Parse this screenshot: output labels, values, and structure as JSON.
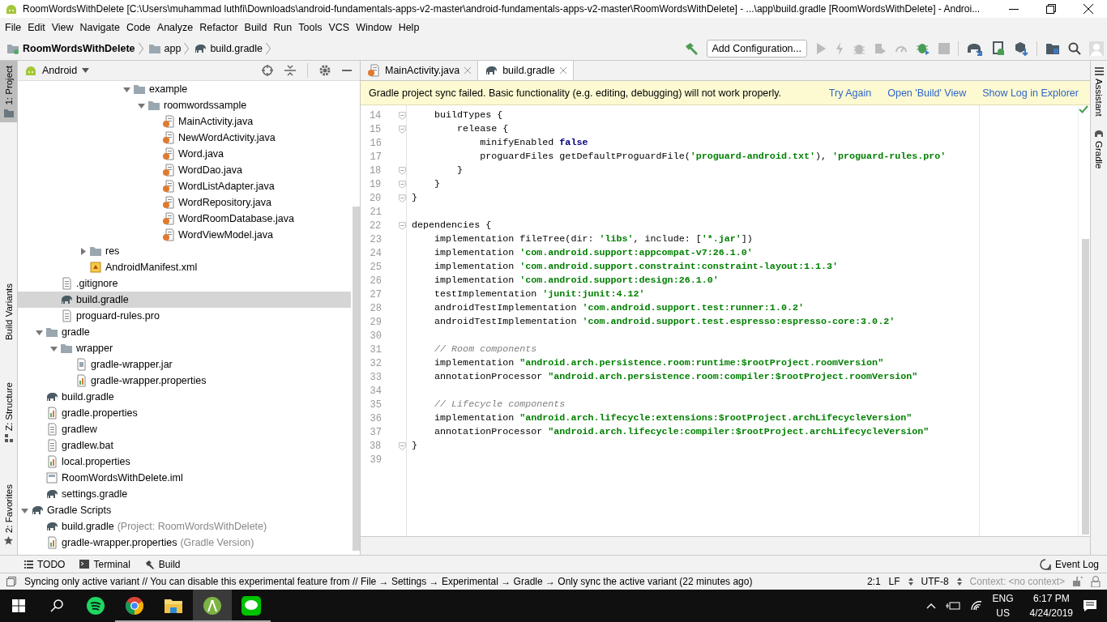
{
  "window": {
    "title": "RoomWordsWithDelete [C:\\Users\\muhammad luthfi\\Downloads\\android-fundamentals-apps-v2-master\\android-fundamentals-apps-v2-master\\RoomWordsWithDelete] - ...\\app\\build.gradle [RoomWordsWithDelete] - Androi..."
  },
  "menu": [
    "File",
    "Edit",
    "View",
    "Navigate",
    "Code",
    "Analyze",
    "Refactor",
    "Build",
    "Run",
    "Tools",
    "VCS",
    "Window",
    "Help"
  ],
  "breadcrumbs": [
    {
      "label": "RoomWordsWithDelete",
      "kind": "project"
    },
    {
      "label": "app",
      "kind": "folder"
    },
    {
      "label": "build.gradle",
      "kind": "gradle"
    }
  ],
  "toolbar": {
    "run_config": "Add Configuration..."
  },
  "left_tool_tabs": [
    {
      "label": "1: Project",
      "kind": "project",
      "selected": true
    },
    {
      "label": "Build Variants",
      "kind": "plain",
      "selected": false
    },
    {
      "label": "Z: Structure",
      "kind": "structure",
      "selected": false
    },
    {
      "label": "2: Favorites",
      "kind": "favorites",
      "selected": false
    }
  ],
  "project_panel": {
    "view": "Android",
    "tree": [
      {
        "children": [
          {
            "children": [
              {
                "children": [
                  {
                    "children": [
                      {
                        "children": [
                          {
                            "children": [
                              {
                                "children": [
                                  {
                                    "label": "example",
                                    "kind": "folder",
                                    "selected": false,
                                    "expanded": true,
                                    "children": [
                                      {
                                        "label": "roomwordssample",
                                        "kind": "folder",
                                        "selected": false,
                                        "expanded": true,
                                        "children": [
                                          {
                                            "label": "MainActivity.java",
                                            "kind": "java",
                                            "selected": false
                                          },
                                          {
                                            "label": "NewWordActivity.java",
                                            "kind": "java",
                                            "selected": false
                                          },
                                          {
                                            "label": "Word.java",
                                            "kind": "java",
                                            "selected": false
                                          },
                                          {
                                            "label": "WordDao.java",
                                            "kind": "java",
                                            "selected": false
                                          },
                                          {
                                            "label": "WordListAdapter.java",
                                            "kind": "java",
                                            "selected": false
                                          },
                                          {
                                            "label": "WordRepository.java",
                                            "kind": "java",
                                            "selected": false
                                          },
                                          {
                                            "label": "WordRoomDatabase.java",
                                            "kind": "java",
                                            "selected": false
                                          },
                                          {
                                            "label": "WordViewModel.java",
                                            "kind": "java",
                                            "selected": false
                                          }
                                        ]
                                      }
                                    ]
                                  }
                                ]
                              }
                            ]
                          }
                        ]
                      },
                      {
                        "label": "res",
                        "kind": "folder",
                        "selected": false,
                        "expanded": false
                      },
                      {
                        "label": "AndroidManifest.xml",
                        "kind": "manifest",
                        "selected": false
                      }
                    ]
                  }
                ]
              },
              {
                "label": ".gitignore",
                "kind": "text",
                "selected": false
              },
              {
                "label": "build.gradle",
                "kind": "gradle",
                "selected": true
              },
              {
                "label": "proguard-rules.pro",
                "kind": "text",
                "selected": false
              }
            ]
          },
          {
            "label": "gradle",
            "kind": "folder",
            "selected": false,
            "expanded": true,
            "children": [
              {
                "label": "wrapper",
                "kind": "folder",
                "selected": false,
                "expanded": true,
                "children": [
                  {
                    "label": "gradle-wrapper.jar",
                    "kind": "jar",
                    "selected": false
                  },
                  {
                    "label": "gradle-wrapper.properties",
                    "kind": "properties",
                    "selected": false
                  }
                ]
              }
            ]
          },
          {
            "label": "build.gradle",
            "kind": "gradle",
            "selected": false
          },
          {
            "label": "gradle.properties",
            "kind": "properties",
            "selected": false
          },
          {
            "label": "gradlew",
            "kind": "text",
            "selected": false
          },
          {
            "label": "gradlew.bat",
            "kind": "text",
            "selected": false
          },
          {
            "label": "local.properties",
            "kind": "properties",
            "selected": false
          },
          {
            "label": "RoomWordsWithDelete.iml",
            "kind": "module",
            "selected": false
          },
          {
            "label": "settings.gradle",
            "kind": "gradle",
            "selected": false
          }
        ]
      },
      {
        "label": "Gradle Scripts",
        "kind": "gradle",
        "selected": false,
        "expanded": true,
        "children": [
          {
            "label": "build.gradle",
            "kind": "gradle",
            "selected": false,
            "note": "(Project: RoomWordsWithDelete)"
          },
          {
            "label": "gradle-wrapper.properties",
            "kind": "properties",
            "selected": false,
            "note": "(Gradle Version)"
          }
        ]
      }
    ]
  },
  "editor_tabs": [
    {
      "label": "MainActivity.java",
      "kind": "java",
      "selected": false
    },
    {
      "label": "build.gradle",
      "kind": "gradle",
      "selected": true
    }
  ],
  "banner": {
    "message": "Gradle project sync failed. Basic functionality (e.g. editing, debugging) will not work properly.",
    "actions": [
      "Try Again",
      "Open 'Build' View",
      "Show Log in Explorer"
    ]
  },
  "code_lines": [
    {
      "number": "14",
      "fold": true,
      "tokens": [
        {
          "kind": "plain",
          "text": "    buildTypes {"
        }
      ]
    },
    {
      "number": "15",
      "fold": true,
      "tokens": [
        {
          "kind": "plain",
          "text": "        release {"
        }
      ]
    },
    {
      "number": "16",
      "fold": false,
      "tokens": [
        {
          "kind": "plain",
          "text": "            minifyEnabled "
        },
        {
          "kind": "keyword",
          "text": "false"
        }
      ]
    },
    {
      "number": "17",
      "fold": false,
      "tokens": [
        {
          "kind": "plain",
          "text": "            proguardFiles getDefaultProguardFile("
        },
        {
          "kind": "string",
          "text": "'proguard-android.txt'"
        },
        {
          "kind": "plain",
          "text": "), "
        },
        {
          "kind": "string",
          "text": "'proguard-rules.pro'"
        }
      ]
    },
    {
      "number": "18",
      "fold": true,
      "tokens": [
        {
          "kind": "plain",
          "text": "        }"
        }
      ]
    },
    {
      "number": "19",
      "fold": true,
      "tokens": [
        {
          "kind": "plain",
          "text": "    }"
        }
      ]
    },
    {
      "number": "20",
      "fold": true,
      "tokens": [
        {
          "kind": "plain",
          "text": "}"
        }
      ]
    },
    {
      "number": "21",
      "fold": false
    },
    {
      "number": "22",
      "fold": true,
      "tokens": [
        {
          "kind": "plain",
          "text": "dependencies {"
        }
      ]
    },
    {
      "number": "23",
      "fold": false,
      "tokens": [
        {
          "kind": "plain",
          "text": "    implementation fileTree(dir: "
        },
        {
          "kind": "string",
          "text": "'libs'"
        },
        {
          "kind": "plain",
          "text": ", include: ["
        },
        {
          "kind": "string",
          "text": "'*.jar'"
        },
        {
          "kind": "plain",
          "text": "])"
        }
      ]
    },
    {
      "number": "24",
      "fold": false,
      "tokens": [
        {
          "kind": "plain",
          "text": "    implementation "
        },
        {
          "kind": "string",
          "text": "'com.android.support:appcompat-v7:26.1.0'"
        }
      ]
    },
    {
      "number": "25",
      "fold": false,
      "tokens": [
        {
          "kind": "plain",
          "text": "    implementation "
        },
        {
          "kind": "string",
          "text": "'com.android.support.constraint:constraint-layout:1.1.3'"
        }
      ]
    },
    {
      "number": "26",
      "fold": false,
      "tokens": [
        {
          "kind": "plain",
          "text": "    implementation "
        },
        {
          "kind": "string",
          "text": "'com.android.support:design:26.1.0'"
        }
      ]
    },
    {
      "number": "27",
      "fold": false,
      "tokens": [
        {
          "kind": "plain",
          "text": "    testImplementation "
        },
        {
          "kind": "string",
          "text": "'junit:junit:4.12'"
        }
      ]
    },
    {
      "number": "28",
      "fold": false,
      "tokens": [
        {
          "kind": "plain",
          "text": "    androidTestImplementation "
        },
        {
          "kind": "string",
          "text": "'com.android.support.test:runner:1.0.2'"
        }
      ]
    },
    {
      "number": "29",
      "fold": false,
      "tokens": [
        {
          "kind": "plain",
          "text": "    androidTestImplementation "
        },
        {
          "kind": "string",
          "text": "'com.android.support.test.espresso:espresso-core:3.0.2'"
        }
      ]
    },
    {
      "number": "30",
      "fold": false
    },
    {
      "number": "31",
      "fold": false,
      "tokens": [
        {
          "kind": "comment",
          "text": "    // Room components"
        }
      ]
    },
    {
      "number": "32",
      "fold": false,
      "tokens": [
        {
          "kind": "plain",
          "text": "    implementation "
        },
        {
          "kind": "string",
          "text": "\"android.arch.persistence.room:runtime:$rootProject.roomVersion\""
        }
      ]
    },
    {
      "number": "33",
      "fold": false,
      "tokens": [
        {
          "kind": "plain",
          "text": "    annotationProcessor "
        },
        {
          "kind": "string",
          "text": "\"android.arch.persistence.room:compiler:$rootProject.roomVersion\""
        }
      ]
    },
    {
      "number": "34",
      "fold": false
    },
    {
      "number": "35",
      "fold": false,
      "tokens": [
        {
          "kind": "comment",
          "text": "    // Lifecycle components"
        }
      ]
    },
    {
      "number": "36",
      "fold": false,
      "tokens": [
        {
          "kind": "plain",
          "text": "    implementation "
        },
        {
          "kind": "string",
          "text": "\"android.arch.lifecycle:extensions:$rootProject.archLifecycleVersion\""
        }
      ]
    },
    {
      "number": "37",
      "fold": false,
      "tokens": [
        {
          "kind": "plain",
          "text": "    annotationProcessor "
        },
        {
          "kind": "string",
          "text": "\"android.arch.lifecycle:compiler:$rootProject.archLifecycleVersion\""
        }
      ]
    },
    {
      "number": "38",
      "fold": true,
      "tokens": [
        {
          "kind": "plain",
          "text": "}"
        }
      ]
    },
    {
      "number": "39",
      "fold": false
    }
  ],
  "right_tool_tabs": [
    {
      "label": "Assistant",
      "kind": "assistant"
    },
    {
      "label": "Gradle",
      "kind": "gradle"
    }
  ],
  "bottom_tools": [
    {
      "label": "TODO",
      "kind": "list"
    },
    {
      "label": "Terminal",
      "kind": "terminal"
    },
    {
      "label": "Build",
      "kind": "hammer"
    }
  ],
  "event_log": "Event Log",
  "status_bar": {
    "message": "Syncing only active variant // You can disable this experimental feature from // File → Settings → Experimental → Gradle → Only sync the active variant (22 minutes ago)",
    "position": "2:1",
    "line_separator": "LF",
    "encoding": "UTF-8",
    "context": "Context: <no context>"
  },
  "taskbar": {
    "apps": [
      {
        "kind": "spotify",
        "selected": false,
        "running": false
      },
      {
        "kind": "chrome",
        "selected": false,
        "running": true
      },
      {
        "kind": "explorer",
        "selected": false,
        "running": true
      },
      {
        "kind": "studio",
        "selected": true,
        "running": true
      },
      {
        "kind": "line",
        "selected": false,
        "running": true
      }
    ],
    "language": "ENG",
    "region": "US",
    "time": "6:17 PM",
    "date": "4/24/2019"
  }
}
